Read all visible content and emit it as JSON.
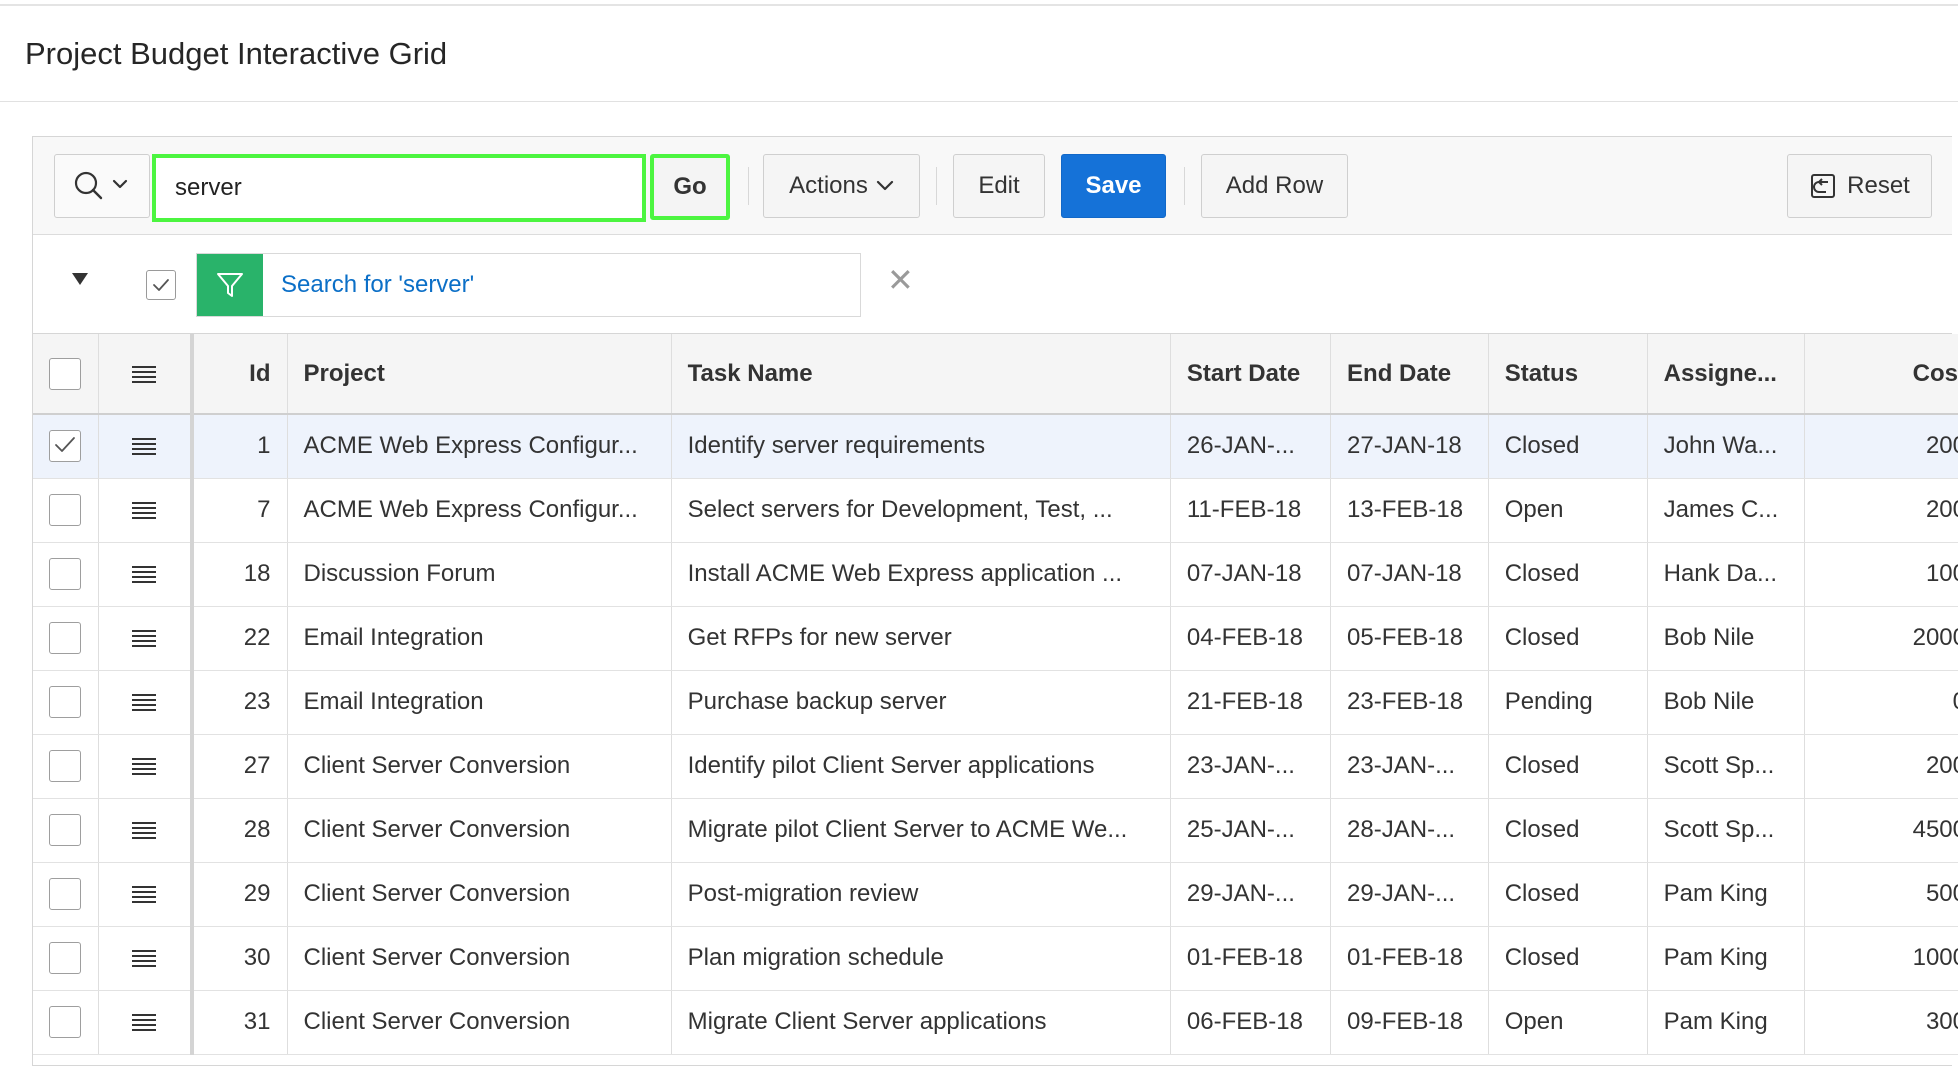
{
  "page": {
    "title": "Project Budget Interactive Grid"
  },
  "toolbar": {
    "search_icon": "search-icon",
    "search_value": "server",
    "go_label": "Go",
    "actions_label": "Actions",
    "edit_label": "Edit",
    "save_label": "Save",
    "add_row_label": "Add Row",
    "reset_label": "Reset"
  },
  "filter": {
    "enabled": true,
    "text": "Search for 'server'",
    "icon": "filter-icon",
    "color": "#29b36a"
  },
  "colors": {
    "accent": "#1572d8",
    "highlight": "#4cf540",
    "link": "#0b6fc7"
  },
  "grid": {
    "columns": [
      "Id",
      "Project",
      "Task Name",
      "Start Date",
      "End Date",
      "Status",
      "Assigne...",
      "Cost"
    ],
    "rows": [
      {
        "selected": true,
        "cells": [
          "1",
          "ACME Web Express Configur...",
          "Identify server requirements",
          "26-JAN-...",
          "27-JAN-18",
          "Closed",
          "John Wa...",
          "200"
        ]
      },
      {
        "selected": false,
        "cells": [
          "7",
          "ACME Web Express Configur...",
          "Select servers for Development, Test, ...",
          "11-FEB-18",
          "13-FEB-18",
          "Open",
          "James C...",
          "200"
        ]
      },
      {
        "selected": false,
        "cells": [
          "18",
          "Discussion Forum",
          "Install ACME Web Express application ...",
          "07-JAN-18",
          "07-JAN-18",
          "Closed",
          "Hank Da...",
          "100"
        ]
      },
      {
        "selected": false,
        "cells": [
          "22",
          "Email Integration",
          "Get RFPs for new server",
          "04-FEB-18",
          "05-FEB-18",
          "Closed",
          "Bob Nile",
          "2000"
        ]
      },
      {
        "selected": false,
        "cells": [
          "23",
          "Email Integration",
          "Purchase backup server",
          "21-FEB-18",
          "23-FEB-18",
          "Pending",
          "Bob Nile",
          "0"
        ]
      },
      {
        "selected": false,
        "cells": [
          "27",
          "Client Server Conversion",
          "Identify pilot Client Server applications",
          "23-JAN-...",
          "23-JAN-...",
          "Closed",
          "Scott Sp...",
          "200"
        ]
      },
      {
        "selected": false,
        "cells": [
          "28",
          "Client Server Conversion",
          "Migrate pilot Client Server to ACME We...",
          "25-JAN-...",
          "28-JAN-...",
          "Closed",
          "Scott Sp...",
          "4500"
        ]
      },
      {
        "selected": false,
        "cells": [
          "29",
          "Client Server Conversion",
          "Post-migration review",
          "29-JAN-...",
          "29-JAN-...",
          "Closed",
          "Pam King",
          "500"
        ]
      },
      {
        "selected": false,
        "cells": [
          "30",
          "Client Server Conversion",
          "Plan migration schedule",
          "01-FEB-18",
          "01-FEB-18",
          "Closed",
          "Pam King",
          "1000"
        ]
      },
      {
        "selected": false,
        "cells": [
          "31",
          "Client Server Conversion",
          "Migrate Client Server applications",
          "06-FEB-18",
          "09-FEB-18",
          "Open",
          "Pam King",
          "300"
        ]
      }
    ]
  }
}
